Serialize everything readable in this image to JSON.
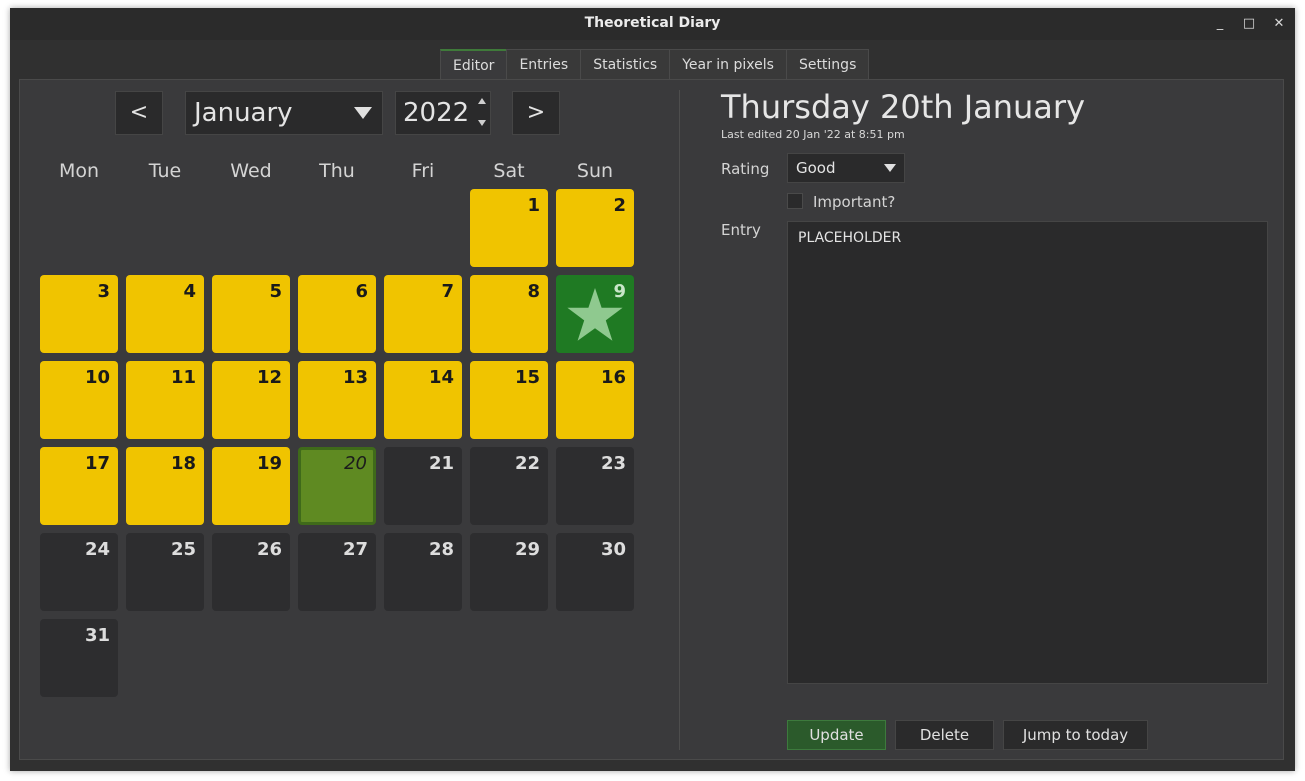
{
  "window": {
    "title": "Theoretical Diary",
    "minimize": "_",
    "maximize": "□",
    "close": "✕"
  },
  "tabs": [
    {
      "label": "Editor",
      "active": true
    },
    {
      "label": "Entries"
    },
    {
      "label": "Statistics"
    },
    {
      "label": "Year in pixels"
    },
    {
      "label": "Settings"
    }
  ],
  "calendar": {
    "prev_label": "<",
    "next_label": ">",
    "month": "January",
    "year": "2022",
    "weekdays": [
      "Mon",
      "Tue",
      "Wed",
      "Thu",
      "Fri",
      "Sat",
      "Sun"
    ],
    "days": [
      {
        "n": "1",
        "state": "yellow"
      },
      {
        "n": "2",
        "state": "yellow"
      },
      {
        "n": "3",
        "state": "yellow"
      },
      {
        "n": "4",
        "state": "yellow"
      },
      {
        "n": "5",
        "state": "yellow"
      },
      {
        "n": "6",
        "state": "yellow"
      },
      {
        "n": "7",
        "state": "yellow"
      },
      {
        "n": "8",
        "state": "yellow"
      },
      {
        "n": "9",
        "state": "green"
      },
      {
        "n": "10",
        "state": "yellow"
      },
      {
        "n": "11",
        "state": "yellow"
      },
      {
        "n": "12",
        "state": "yellow"
      },
      {
        "n": "13",
        "state": "yellow"
      },
      {
        "n": "14",
        "state": "yellow"
      },
      {
        "n": "15",
        "state": "yellow"
      },
      {
        "n": "16",
        "state": "yellow"
      },
      {
        "n": "17",
        "state": "yellow"
      },
      {
        "n": "18",
        "state": "yellow"
      },
      {
        "n": "19",
        "state": "yellow"
      },
      {
        "n": "20",
        "state": "selected"
      },
      {
        "n": "21",
        "state": "empty"
      },
      {
        "n": "22",
        "state": "empty"
      },
      {
        "n": "23",
        "state": "empty"
      },
      {
        "n": "24",
        "state": "empty"
      },
      {
        "n": "25",
        "state": "empty"
      },
      {
        "n": "26",
        "state": "empty"
      },
      {
        "n": "27",
        "state": "empty"
      },
      {
        "n": "28",
        "state": "empty"
      },
      {
        "n": "29",
        "state": "empty"
      },
      {
        "n": "30",
        "state": "empty"
      },
      {
        "n": "31",
        "state": "empty"
      }
    ],
    "first_weekday_index": 5,
    "colors": {
      "good": "#f0c400",
      "great": "#1f7a23",
      "selected": "#5f8a22",
      "none": "#2d2d2f"
    },
    "star_icon": "star-icon"
  },
  "editor": {
    "date_heading": "Thursday 20th January",
    "last_edited": "Last edited 20 Jan '22 at 8:51 pm",
    "rating_label": "Rating",
    "rating_value": "Good",
    "important_label": "Important?",
    "important_checked": false,
    "entry_label": "Entry",
    "entry_text": "PLACEHOLDER",
    "update_label": "Update",
    "delete_label": "Delete",
    "jump_label": "Jump to today"
  }
}
